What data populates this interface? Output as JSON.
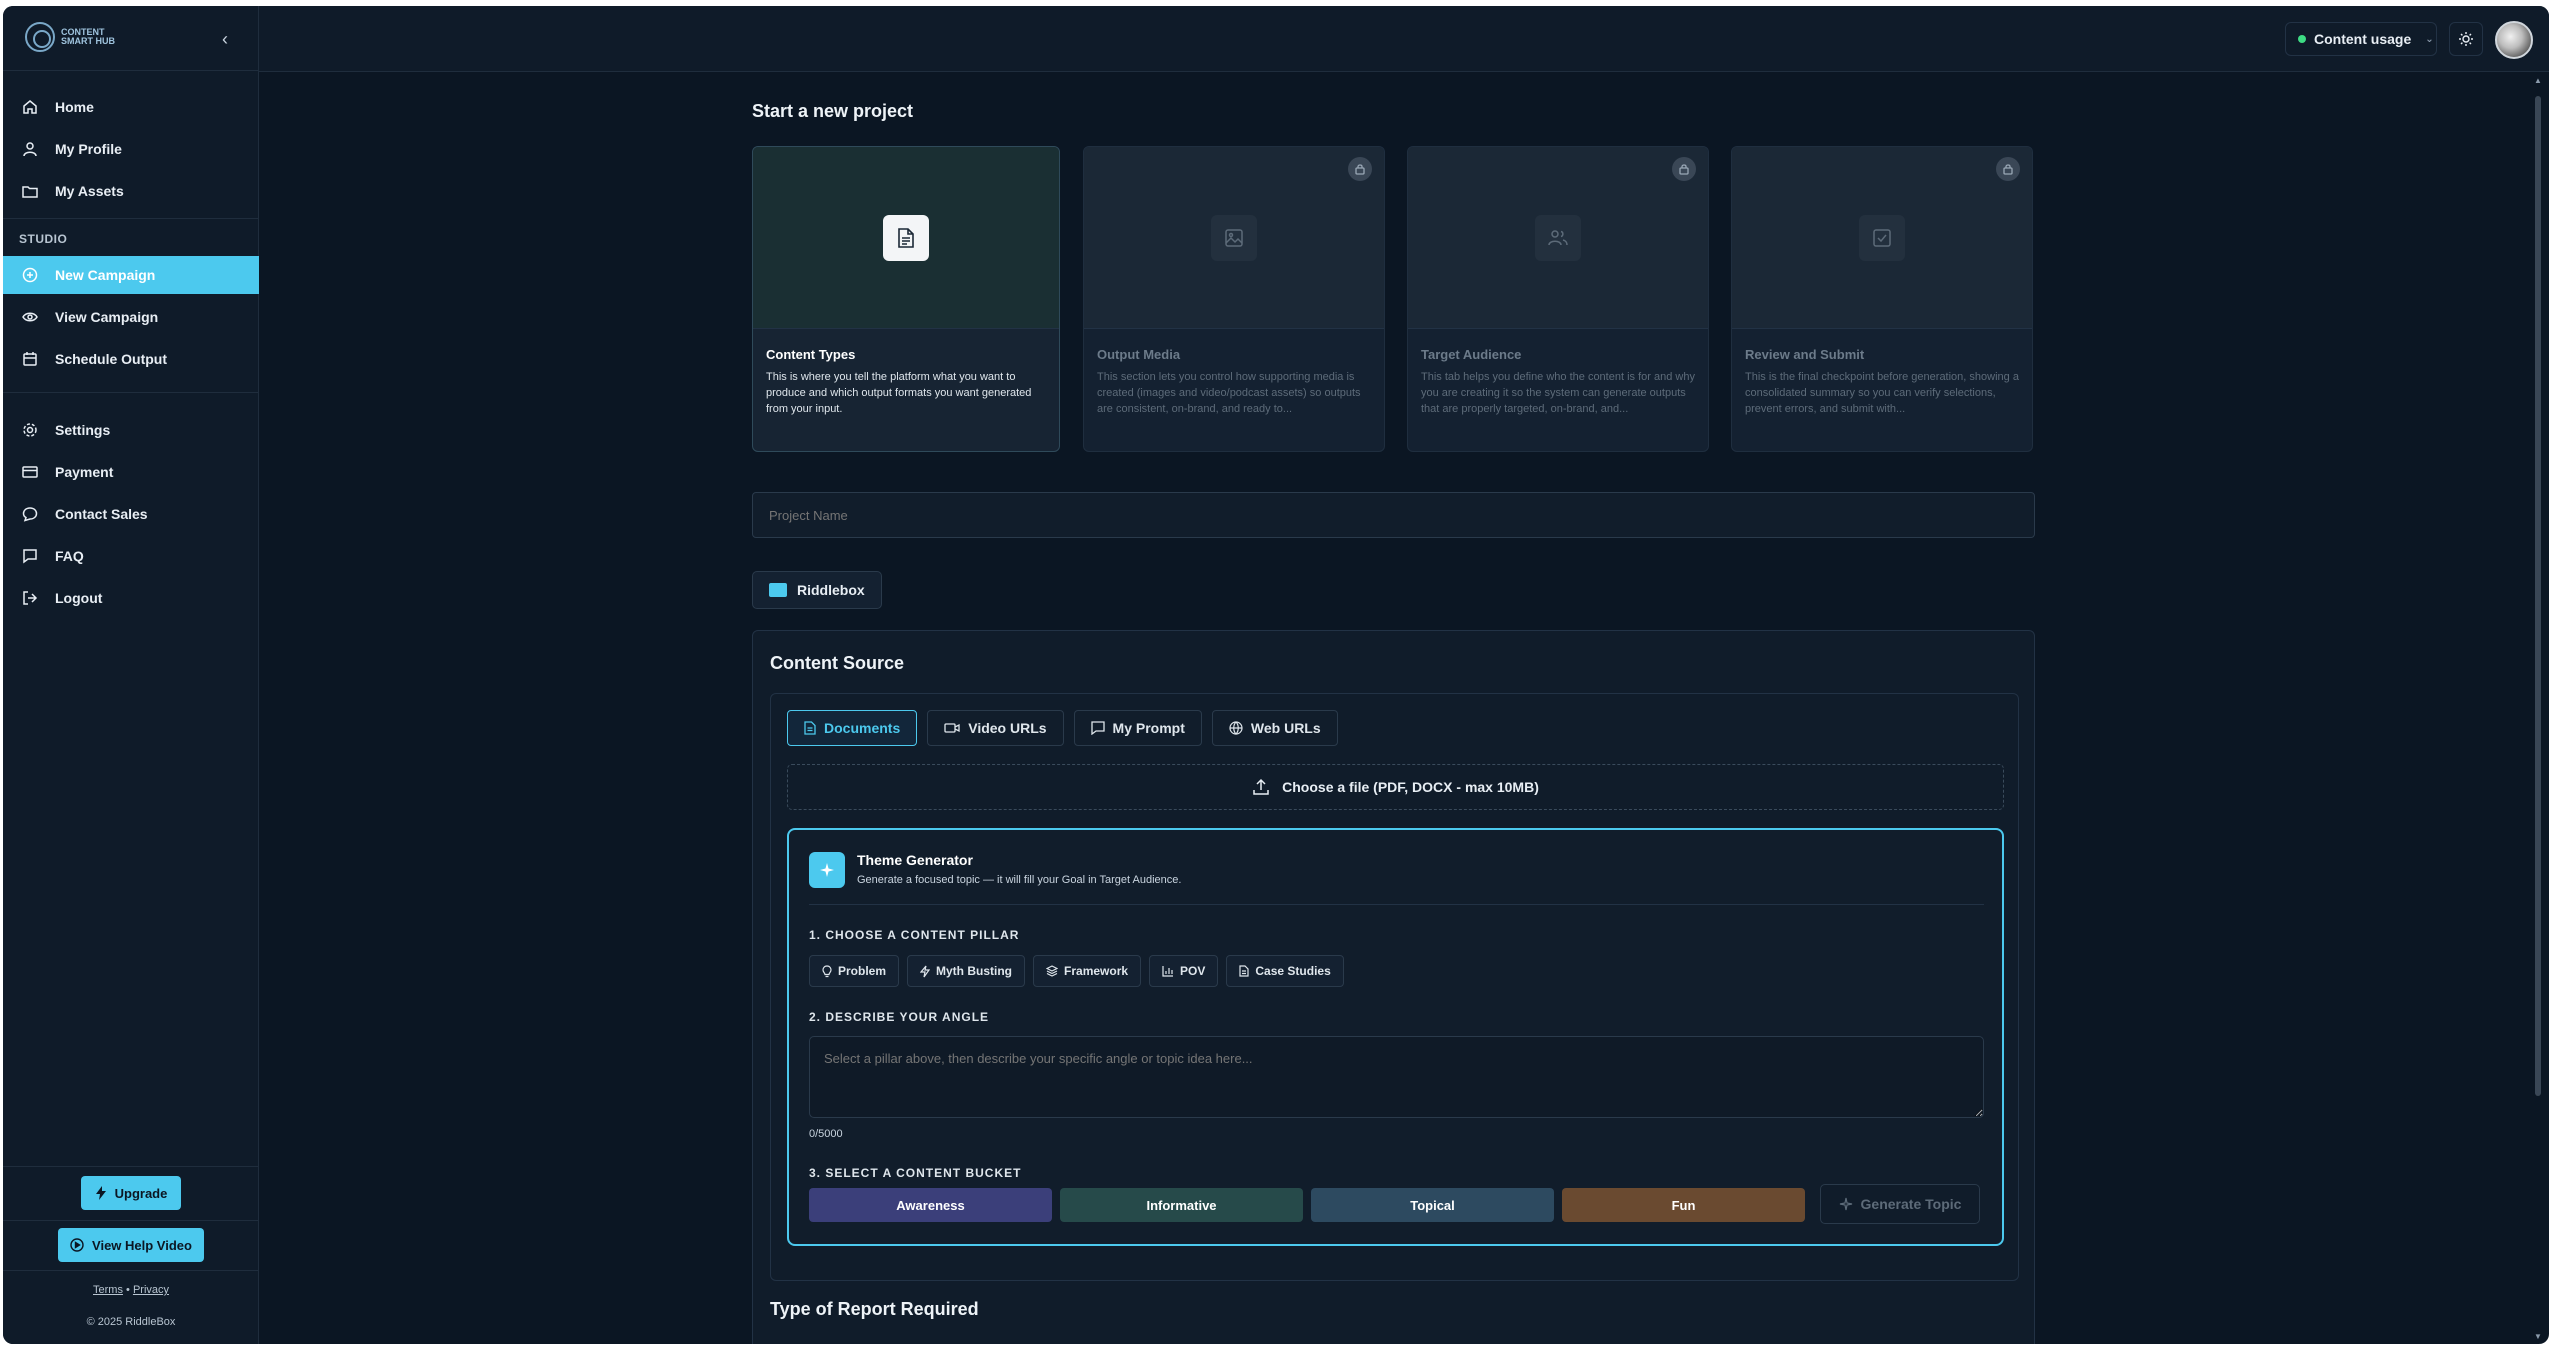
{
  "brand": {
    "logo_text": "CONTENT SMART HUB"
  },
  "sidebar": {
    "collapse_icon": "chevron-left-icon",
    "top_items": [
      {
        "label": "Home",
        "icon": "home-icon"
      },
      {
        "label": "My Profile",
        "icon": "user-icon"
      },
      {
        "label": "My Assets",
        "icon": "folder-icon"
      }
    ],
    "section_label": "STUDIO",
    "studio_items": [
      {
        "label": "New Campaign",
        "icon": "plus-circle-icon",
        "active": true
      },
      {
        "label": "View Campaign",
        "icon": "eye-icon"
      },
      {
        "label": "Schedule Output",
        "icon": "calendar-icon"
      }
    ],
    "bottom_items": [
      {
        "label": "Settings",
        "icon": "gear-icon"
      },
      {
        "label": "Payment",
        "icon": "credit-card-icon"
      },
      {
        "label": "Contact Sales",
        "icon": "chat-bubble-icon"
      },
      {
        "label": "FAQ",
        "icon": "message-square-icon"
      },
      {
        "label": "Logout",
        "icon": "logout-icon"
      }
    ],
    "upgrade_label": "Upgrade",
    "help_video_label": "View Help Video",
    "terms_label": "Terms",
    "legal_sep": "•",
    "privacy_label": "Privacy",
    "copyright": "© 2025 RiddleBox"
  },
  "topbar": {
    "usage_label": "Content usage",
    "usage_status_color": "#3ddc84"
  },
  "main": {
    "title": "Start a new project",
    "cards": [
      {
        "title": "Content Types",
        "desc": "This is where you tell the platform what you want to produce and which output formats you want generated from your input.",
        "icon": "document-icon",
        "locked": false,
        "active": true
      },
      {
        "title": "Output Media",
        "desc": "This section lets you control how supporting media is created (images and video/podcast assets) so outputs are consistent, on-brand, and ready to...",
        "icon": "image-icon",
        "locked": true
      },
      {
        "title": "Target Audience",
        "desc": "This tab helps you define who the content is for and why you are creating it so the system can generate outputs that are properly targeted, on-brand, and...",
        "icon": "users-icon",
        "locked": true
      },
      {
        "title": "Review and Submit",
        "desc": "This is the final checkpoint before generation, showing a consolidated summary so you can verify selections, prevent errors, and submit with...",
        "icon": "check-square-icon",
        "locked": true
      }
    ],
    "project_name_placeholder": "Project Name",
    "workspace_chip": "Riddlebox",
    "content_source": {
      "title": "Content Source",
      "tabs": [
        {
          "label": "Documents",
          "icon": "document-icon",
          "active": true
        },
        {
          "label": "Video URLs",
          "icon": "video-icon"
        },
        {
          "label": "My Prompt",
          "icon": "chat-bubble-icon"
        },
        {
          "label": "Web URLs",
          "icon": "globe-icon"
        }
      ],
      "upload_label": "Choose a file (PDF, DOCX - max 10MB)",
      "theme_generator": {
        "title": "Theme Generator",
        "subtitle": "Generate a focused topic — it will fill your Goal in Target Audience.",
        "step1": "1. CHOOSE A CONTENT PILLAR",
        "pillars": [
          {
            "label": "Problem",
            "icon": "lightbulb-icon"
          },
          {
            "label": "Myth Busting",
            "icon": "zap-icon"
          },
          {
            "label": "Framework",
            "icon": "layers-icon"
          },
          {
            "label": "POV",
            "icon": "bar-chart-icon"
          },
          {
            "label": "Case Studies",
            "icon": "document-icon"
          }
        ],
        "step2": "2. DESCRIBE YOUR ANGLE",
        "angle_placeholder": "Select a pillar above, then describe your specific angle or topic idea here...",
        "counter": "0/5000",
        "step3": "3. SELECT A CONTENT BUCKET",
        "buckets": [
          {
            "label": "Awareness",
            "color": "#3b3f7a"
          },
          {
            "label": "Informative",
            "color": "#264a4a"
          },
          {
            "label": "Topical",
            "color": "#2d4a60"
          },
          {
            "label": "Fun",
            "color": "#6a4a30"
          }
        ],
        "generate_label": "Generate Topic"
      }
    },
    "report_title": "Type of Report Required"
  },
  "colors": {
    "accent": "#4cc9ee",
    "background": "#0b1623",
    "panel": "#0f1b29"
  }
}
